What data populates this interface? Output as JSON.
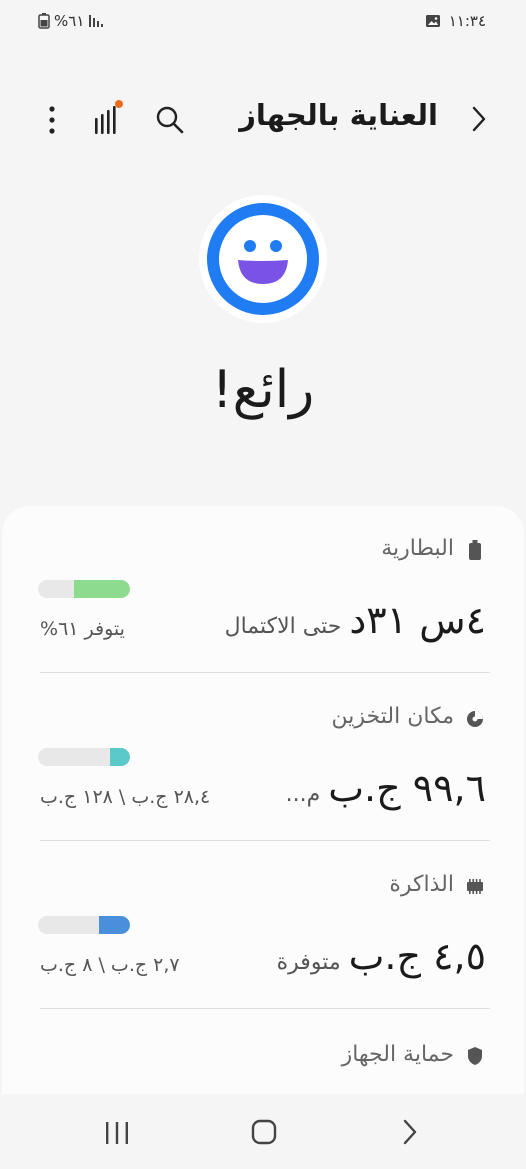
{
  "status_bar": {
    "time": "١١:٣٤",
    "battery": "%٦١"
  },
  "header": {
    "title": "العناية بالجهاز"
  },
  "overview": {
    "status": "رائع!"
  },
  "battery": {
    "title": "البطارية",
    "value": "٤س ٣١د",
    "sub": "حتى الاكتمال",
    "available": "يتوفر ٦١%",
    "level_fraction": 0.61,
    "bar_color": "#8cdb8f"
  },
  "storage": {
    "title": "مكان التخزين",
    "value": "٩٩,٦ ج.ب",
    "sub": "م...",
    "usage": "٢٨,٤ ج.ب \\ ١٢٨ ج.ب",
    "level_fraction": 0.22,
    "bar_color": "#5bc8c9"
  },
  "memory": {
    "title": "الذاكرة",
    "value": "٤,٥ ج.ب",
    "sub": "متوفرة",
    "usage": "٢,٧ ج.ب \\ ٨ ج.ب",
    "level_fraction": 0.34,
    "bar_color": "#4a8fd9"
  },
  "protection": {
    "title": "حماية الجهاز"
  },
  "colors": {
    "face_ring": "#1f7cf3",
    "notification_dot": "#ef6c1a"
  }
}
